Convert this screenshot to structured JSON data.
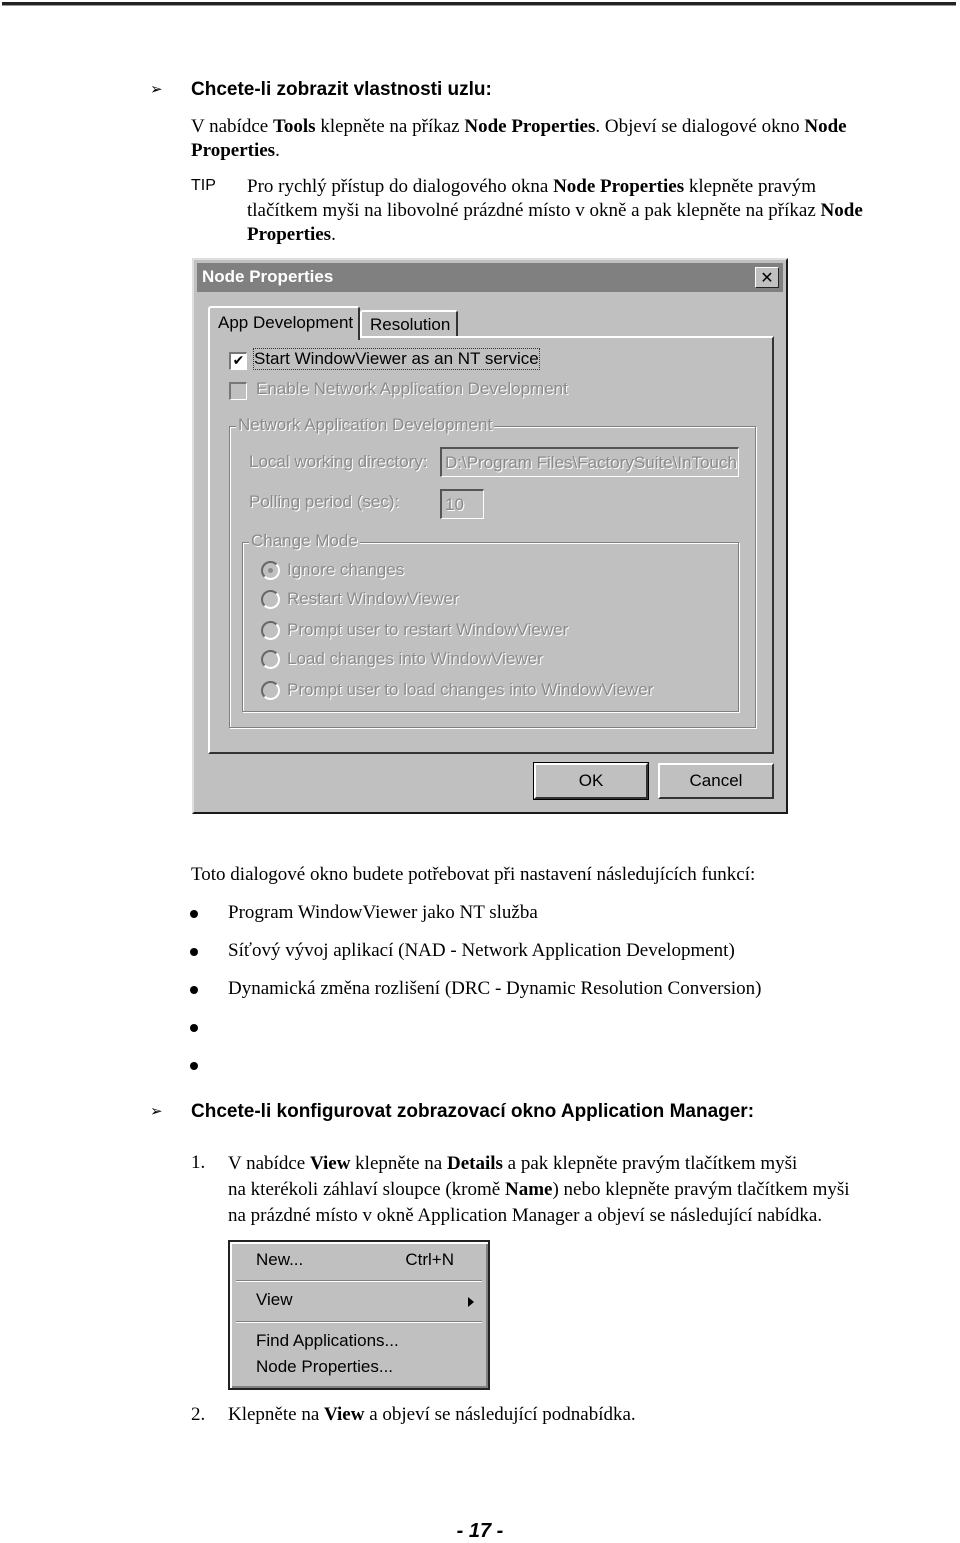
{
  "section1": {
    "heading": "Chcete-li zobrazit vlastnosti uzlu:",
    "para_parts": [
      "V nabídce ",
      "Tools",
      " klepněte na příkaz ",
      "Node Properties",
      ". Objeví se dialogové okno ",
      "Node",
      "Properties",
      "."
    ],
    "tip": {
      "label": "TIP",
      "line1_parts": [
        "Pro rychlý přístup do dialogového okna ",
        "Node Properties",
        " klepněte pravým"
      ],
      "line2_parts": [
        "tlačítkem myši na libovolné prázdné místo v okně a pak klepněte na příkaz ",
        "Node"
      ],
      "line3_parts": [
        "Properties",
        "."
      ]
    }
  },
  "dialog": {
    "title": "Node Properties",
    "close_glyph": "✕",
    "tabs": [
      {
        "label": "App Development",
        "active": true
      },
      {
        "label": "Resolution",
        "active": false
      }
    ],
    "checkbox_nt_service": {
      "label": "Start WindowViewer as an NT service",
      "checked": true,
      "glyph": "✔"
    },
    "checkbox_nad": {
      "label": "Enable Network Application Development",
      "checked": false
    },
    "nad_group": {
      "legend": "Network Application Development",
      "local_dir_label": "Local working directory:",
      "local_dir_value": "D:\\Program Files\\FactorySuite\\InTouch",
      "polling_label": "Polling period (sec):",
      "polling_value": "10"
    },
    "change_mode": {
      "legend": "Change Mode",
      "options": [
        {
          "label": "Ignore changes",
          "selected": true
        },
        {
          "label": "Restart WindowViewer",
          "selected": false
        },
        {
          "label": "Prompt user to restart WindowViewer",
          "selected": false
        },
        {
          "label": "Load changes into WindowViewer",
          "selected": false
        },
        {
          "label": "Prompt user to load changes into WindowViewer",
          "selected": false
        }
      ]
    },
    "ok_label": "OK",
    "cancel_label": "Cancel"
  },
  "section_uses": {
    "intro": "Toto dialogové okno budete potřebovat při nastavení následujících funkcí:",
    "bullets": [
      "Program WindowViewer jako NT služba",
      "Síťový vývoj aplikací (NAD - Network Application Development)",
      "Dynamická změna rozlišení (DRC - Dynamic Resolution Conversion)",
      "",
      ""
    ]
  },
  "section2": {
    "heading": "Chcete-li konfigurovat zobrazovací okno Application Manager:",
    "step1": {
      "number": "1.",
      "line1_parts": [
        "V nabídce ",
        "View",
        " klepněte na ",
        "Details",
        " a pak klepněte pravým tlačítkem myši"
      ],
      "line2_parts": [
        "na kterékoli záhlaví sloupce (kromě ",
        "Name",
        ") nebo klepněte pravým tlačítkem myši"
      ],
      "line3": "na prázdné místo v okně Application Manager a objeví se následující nabídka."
    },
    "context_menu": {
      "items": [
        {
          "label": "New...",
          "shortcut": "Ctrl+N"
        },
        {
          "label": "View",
          "submenu": true
        },
        {
          "label": "Find Applications..."
        },
        {
          "label": "Node Properties..."
        }
      ]
    },
    "step2": {
      "number": "2.",
      "parts": [
        "Klepněte na ",
        "View",
        " a objeví se následující podnabídka."
      ]
    }
  },
  "footer": {
    "page_number": "- 17 -"
  }
}
